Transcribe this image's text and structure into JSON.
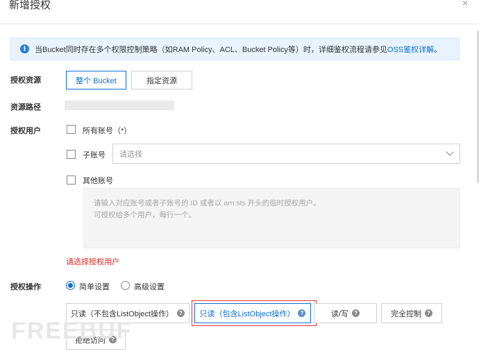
{
  "dialog": {
    "title": "新增授权",
    "close_icon": "×"
  },
  "notice": {
    "icon": "info-icon",
    "text": "当Bucket同时存在多个权限控制策略（如RAM Policy、ACL、Bucket Policy等）时，详细鉴权流程请参见",
    "link": "OSS鉴权详解",
    "suffix": "。"
  },
  "resource": {
    "label": "授权资源",
    "options": [
      "整个 Bucket",
      "指定资源"
    ],
    "selected": "整个 Bucket"
  },
  "path": {
    "label": "资源路径"
  },
  "users": {
    "label": "授权用户",
    "all_accounts": "所有账号（*）",
    "sub_account": "子账号",
    "sub_placeholder": "请选择",
    "other_account": "其他账号",
    "textarea_line1": "请输入对应账号或者子账号的 ID 或者以 arn:sts 开头的临时授权用户。",
    "textarea_line2": "可授权给多个用户，每行一个。",
    "error": "请选择授权用户"
  },
  "operation": {
    "label": "授权操作",
    "radios": [
      "简单设置",
      "高级设置"
    ],
    "selected": "简单设置",
    "buttons": [
      "只读（不包含ListObject操作）",
      "只读（包含ListObject操作）",
      "读/写",
      "完全控制",
      "拒绝访问"
    ],
    "selected_button": "只读（包含ListObject操作）",
    "help_icon": "?"
  },
  "watermark": "FREEBUF"
}
